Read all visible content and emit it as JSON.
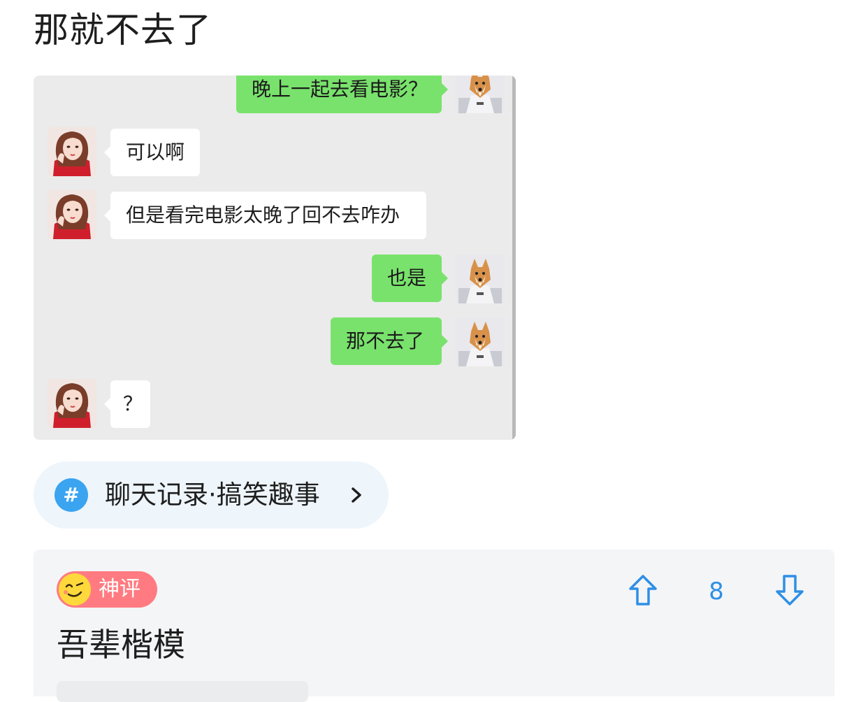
{
  "post": {
    "title": "那就不去了"
  },
  "chat": {
    "messages": [
      {
        "side": "out",
        "text": "晚上一起去看电影？"
      },
      {
        "side": "in",
        "text": "可以啊"
      },
      {
        "side": "in",
        "text": "但是看完电影太晚了回不去咋办"
      },
      {
        "side": "out",
        "text": "也是"
      },
      {
        "side": "out",
        "text": "那不去了"
      },
      {
        "side": "in",
        "text": "？"
      }
    ],
    "avatars": {
      "self": "shiba-dog-avatar",
      "other": "girl-red-dress-avatar"
    },
    "colors": {
      "background": "#ebebeb",
      "out_bubble": "#79e26c",
      "in_bubble": "#ffffff"
    }
  },
  "topic": {
    "icon": "hash-icon",
    "label": "聊天记录·搞笑趣事"
  },
  "comment": {
    "badge": {
      "icon": "smiley-icon",
      "label": "神评"
    },
    "votes": {
      "count": "8"
    },
    "text": "吾辈楷模",
    "colors": {
      "badge": "#ff7b81",
      "accent": "#2e8fe6"
    }
  }
}
